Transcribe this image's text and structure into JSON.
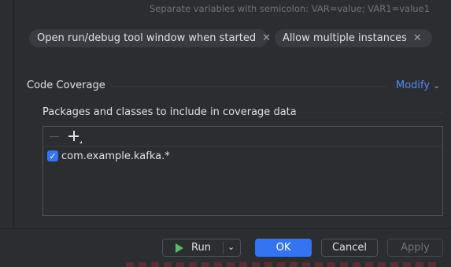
{
  "env_hint": "Separate variables with semicolon: VAR=value; VAR1=value1",
  "chips": [
    {
      "label": "Open run/debug tool window when started",
      "remove_icon": "close-icon"
    },
    {
      "label": "Allow multiple instances",
      "remove_icon": "close-icon"
    }
  ],
  "code_coverage": {
    "title": "Code Coverage",
    "modify_label": "Modify",
    "packages_title": "Packages and classes to include in coverage data",
    "toolbar": {
      "remove_icon": "minus-icon",
      "add_icon": "add-icon"
    },
    "entries": [
      {
        "label": "com.example.kafka.*",
        "checked": true
      }
    ]
  },
  "footer": {
    "run_label": "Run",
    "ok_label": "OK",
    "cancel_label": "Cancel",
    "apply_label": "Apply"
  },
  "colors": {
    "background": "#2b2d30",
    "accent": "#3574f0",
    "link": "#548af7",
    "run_green": "#5fb865"
  }
}
